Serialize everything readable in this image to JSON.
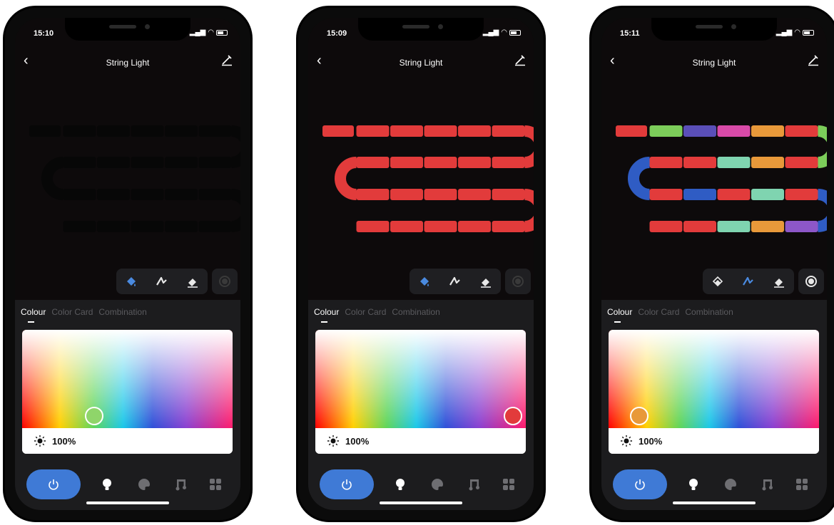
{
  "phones": [
    {
      "time": "15:10",
      "nav": {
        "title": "String Light"
      },
      "tabs": [
        "Colour",
        "Color Card",
        "Combination"
      ],
      "active_tab": "Colour",
      "brightness": "100%",
      "selected_color": "#8fd56a",
      "selected_tool": "fill",
      "strip_state": "off",
      "record_active": false
    },
    {
      "time": "15:09",
      "nav": {
        "title": "String Light"
      },
      "tabs": [
        "Colour",
        "Color Card",
        "Combination"
      ],
      "active_tab": "Colour",
      "brightness": "100%",
      "selected_color": "#e23b3b",
      "selected_tool": "fill",
      "strip_state": "solid-red",
      "record_active": false
    },
    {
      "time": "15:11",
      "nav": {
        "title": "String Light"
      },
      "tabs": [
        "Colour",
        "Color Card",
        "Combination"
      ],
      "active_tab": "Colour",
      "brightness": "100%",
      "selected_color": "#e8993a",
      "selected_tool": "pen",
      "strip_state": "multicolor",
      "record_active": true
    }
  ],
  "colors": {
    "accent": "#3f7ad6",
    "red": "#e23b3b",
    "green": "#7ccd5a",
    "blue": "#2f5cc4",
    "purple": "#5a4fb8",
    "magenta": "#d84aa8",
    "orange": "#e8993a",
    "teal": "#7fd4b0",
    "violet": "#8d57c8"
  },
  "icons": {
    "back": "chevron-left-icon",
    "edit": "pencil-icon",
    "tools": [
      "fill-bucket-icon",
      "pen-icon",
      "eraser-icon"
    ],
    "record": "record-icon",
    "brightness": "sun-icon",
    "nav": [
      "power-icon",
      "bulb-icon",
      "palette-icon",
      "music-icon",
      "grid-icon"
    ]
  }
}
